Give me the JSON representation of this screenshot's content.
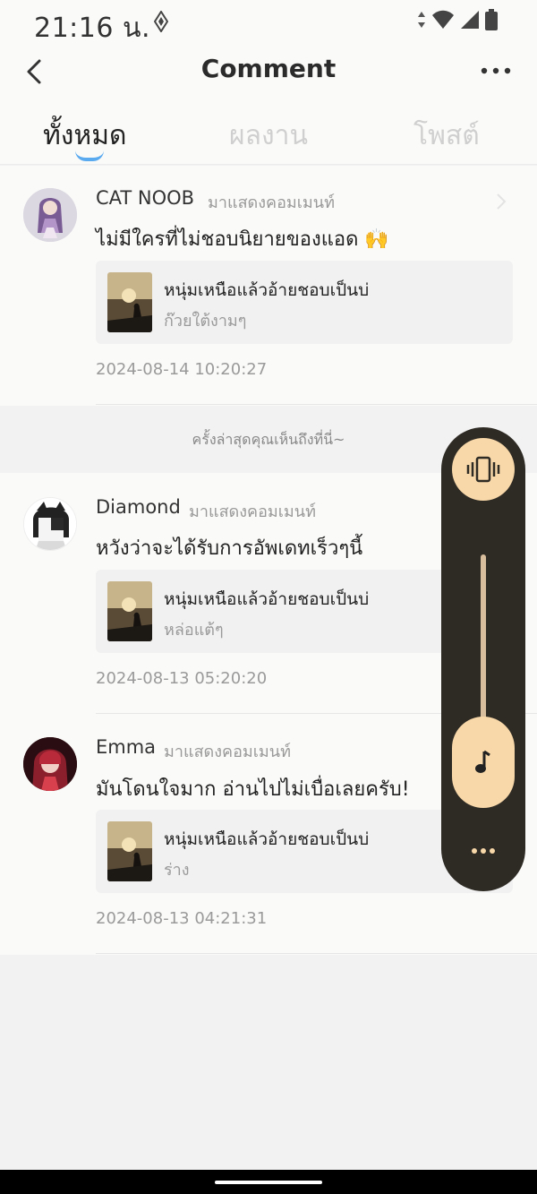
{
  "status_bar": {
    "time": "21:16 น."
  },
  "header": {
    "title": "Comment"
  },
  "tabs": [
    {
      "label": "ทั้งหมด"
    },
    {
      "label": "ผลงาน"
    },
    {
      "label": "โพสต์"
    }
  ],
  "comments": [
    {
      "username": "CAT NOOB",
      "label": "มาแสดงคอมเมนท์",
      "text": "ไม่มีใครที่ไม่ชอบนิยายของแอด 🙌",
      "ref_title": "หนุ่มเหนือแล้วอ้ายชอบเป็นบ่",
      "ref_subtitle": "ก๊วยใต้งามๆ",
      "timestamp": "2024-08-14 10:20:27"
    },
    {
      "username": "Diamond",
      "label": "มาแสดงคอมเมนท์",
      "text": "หวังว่าจะได้รับการอัพเดทเร็วๆนี้",
      "ref_title": "หนุ่มเหนือแล้วอ้ายชอบเป็นบ่",
      "ref_subtitle": "หล่อแต้ๆ",
      "timestamp": "2024-08-13 05:20:20"
    },
    {
      "username": "Emma",
      "label": "มาแสดงคอมเมนท์",
      "text": "มันโดนใจมาก อ่านไปไม่เบื่อเลยครับ!",
      "ref_title": "หนุ่มเหนือแล้วอ้ายชอบเป็นบ่",
      "ref_subtitle": "ร่าง",
      "timestamp": "2024-08-13 04:21:31"
    }
  ],
  "divider_notice": "ครั้งล่าสุดคุณเห็นถึงที่นี่~",
  "volume_panel": {
    "level": 0.05,
    "icons": [
      "vibrate-icon",
      "music-note-icon",
      "more-dots-icon"
    ]
  },
  "colors": {
    "accent": "#5aaaf0",
    "panel": "#2e2a24",
    "panel_button": "#f8d8a8"
  }
}
